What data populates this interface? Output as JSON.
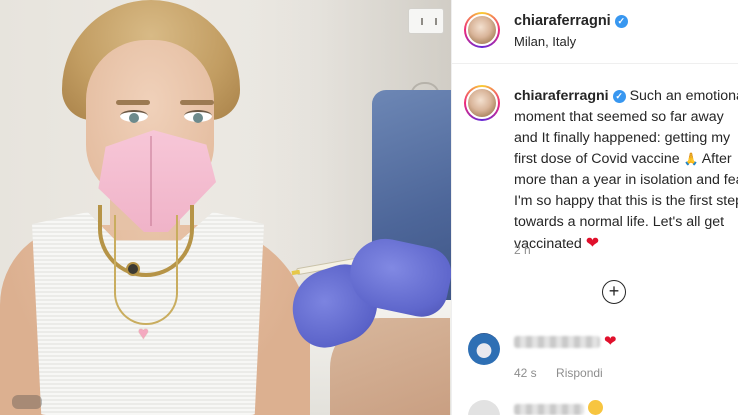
{
  "post": {
    "username": "chiaraferragni",
    "location": "Milan, Italy",
    "caption": "Such an emotional moment that seemed so far away and It finally happened: getting my first dose of Covid vaccine",
    "caption_2": "After more than a year in isolation and fear I'm so happy that this is the first step towards a normal life. Let's all get vaccinated",
    "time_ago": "2 h"
  },
  "icons": {
    "verified": "verified-badge-icon",
    "pray": "folded-hands-emoji",
    "heart": "red-heart-emoji",
    "add": "add-circle-icon",
    "star_eyes": "star-struck-emoji"
  },
  "comment": {
    "time_ago": "42 s",
    "reply_label": "Rispondi"
  },
  "colors": {
    "verified": "#3897f0",
    "heart": "#e0102c",
    "muted_text": "#8e8e8e",
    "glove": "#5b63c9",
    "mask": "#f0b3c8"
  }
}
